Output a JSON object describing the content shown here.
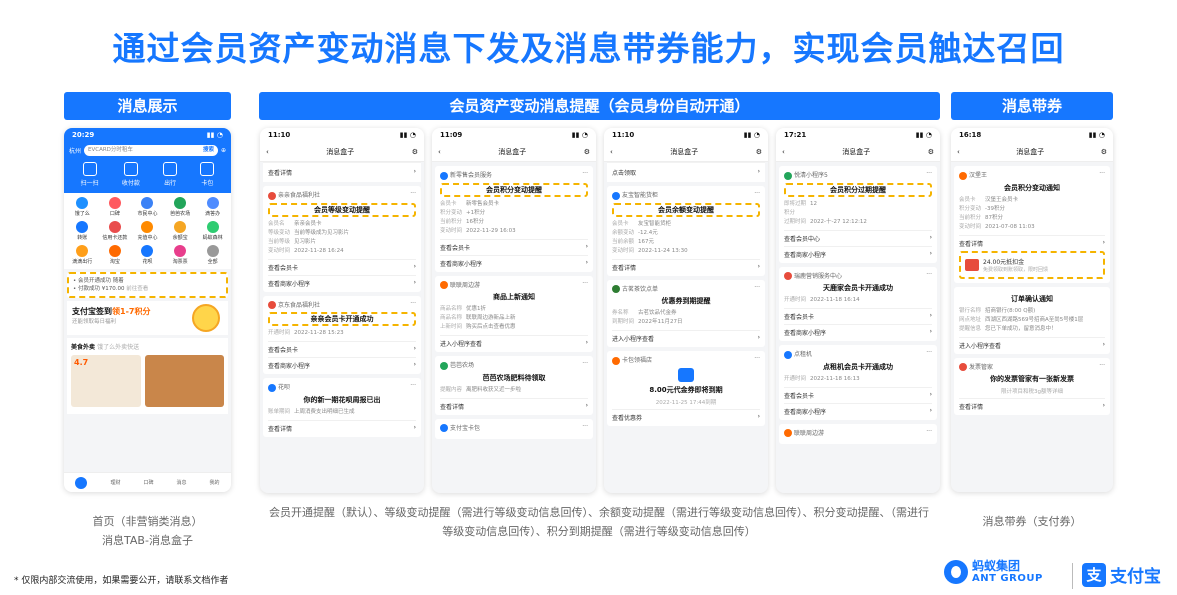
{
  "title": "通过会员资产变动消息下发及消息带券能力，实现会员触达召回",
  "sections": {
    "display": "消息展示",
    "asset": "会员资产变动消息提醒（会员身份自动开通）",
    "coupon": "消息带券"
  },
  "phone1": {
    "time": "20:29",
    "city": "杭州",
    "search_placeholder": "EVCARD分时租车",
    "search_btn": "搜索",
    "top_icons": [
      "扫一扫",
      "收付款",
      "出行",
      "卡包"
    ],
    "grid": [
      "饿了么",
      "口碑",
      "市民中心",
      "芭芭农场",
      "滴答办",
      "转账",
      "信用卡还款",
      "充值中心",
      "余额宝",
      "蚂蚁森林",
      "滴滴出行",
      "淘宝",
      "花呗",
      "淘票票",
      "全部"
    ],
    "msg1": "• 会员开通成功 随着",
    "msg2": "• 付款成功 ¥170.00",
    "msg_suffix": "前往查看",
    "banner_title": "支付宝签到",
    "banner_highlight": "领1-7积分",
    "banner_sub": "还能领取每日福利",
    "food_title": "美食外卖",
    "food_sub": "饿了么外卖快送",
    "food_price": "4.7",
    "tabs": [
      "首页",
      "理财",
      "口碑",
      "消息",
      "我的"
    ]
  },
  "phone2": {
    "time": "11:10",
    "nav_title": "消息盒子",
    "top_link": "查看详情",
    "card1_src": "亲亲食品福利社",
    "card1_title": "会员等级变动提醒",
    "card1_kv": [
      [
        "会员名",
        "亲亲会员卡"
      ],
      [
        "等级变动",
        "当前等级成为见习影片"
      ],
      [
        "当前等级",
        "见习影片"
      ],
      [
        "变动时间",
        "2022-11-28 16:24"
      ]
    ],
    "card1_links": [
      "查看会员卡",
      "查看商家小程序"
    ],
    "card2_src": "京东食品福利社",
    "card2_title": "亲亲会员卡开通成功",
    "card2_kv": [
      [
        "开通时间",
        "2022-11-28 15:23"
      ]
    ],
    "card2_links": [
      "查看会员卡",
      "查看商家小程序"
    ],
    "card3_src": "花呗",
    "card3_title": "你的新一期花呗周报已出",
    "card3_kv": [
      [
        "账单期间",
        "上周消费支出明细已生成"
      ]
    ],
    "card3_links": [
      "查看详情"
    ]
  },
  "phone3": {
    "time": "11:09",
    "nav_title": "消息盒子",
    "card1_src": "新零售会员服务",
    "card1_title": "会员积分变动提醒",
    "card1_kv": [
      [
        "会员卡",
        "新零售会员卡"
      ],
      [
        "积分变动",
        "+1积分"
      ],
      [
        "当前积分",
        "16积分"
      ],
      [
        "变动时间",
        "2022-11-29 16:03"
      ]
    ],
    "card1_links": [
      "查看会员卡",
      "查看商家小程序"
    ],
    "card2_src": "联联周边游",
    "card2_title": "商品上新通知",
    "card2_kv": [
      [
        "商品名称",
        "优惠1折"
      ],
      [
        "商品名称",
        "联联周边游新品上新"
      ],
      [
        "上新时间",
        "购买后点击查看优惠"
      ]
    ],
    "card2_links": [
      "进入小程序查看"
    ],
    "card3_src": "芭芭农场",
    "card3_title": "芭芭农场肥料待领取",
    "card3_kv": [
      [
        "提醒内容",
        "离肥料收获又近一步啦"
      ]
    ],
    "card3_links": [
      "查看详情"
    ],
    "card4_src": "支付宝卡包"
  },
  "phone4": {
    "time": "11:10",
    "nav_title": "消息盒子",
    "top_link": "点击领取",
    "card1_src": "友宝智能货柜",
    "card1_title": "会员余额变动提醒",
    "card1_kv": [
      [
        "会员卡",
        "友宝智能货柜"
      ],
      [
        "余额变动",
        "-12.4元"
      ],
      [
        "当前余额",
        "167元"
      ],
      [
        "变动时间",
        "2022-11-24 13:30"
      ]
    ],
    "card1_links": [
      "查看详情"
    ],
    "card2_src": "古茗茶饮点单",
    "card2_title": "优惠券到期提醒",
    "card2_kv": [
      [
        "券名称",
        "古茗饮品代金券"
      ],
      [
        "到期时间",
        "2022年11月27日"
      ]
    ],
    "card2_links": [
      "进入小程序查看"
    ],
    "card3_src": "卡包领福店",
    "card3_title": "8.00元代金券即将到期",
    "card3_date": "2022-11-25 17:44到期",
    "card3_links": [
      "查看优惠券"
    ]
  },
  "phone5": {
    "time": "17:21",
    "nav_title": "消息盒子",
    "card1_src": "悦清小程序5",
    "card1_title": "会员积分过期提醒",
    "card1_kv": [
      [
        "即将过期积分",
        "12"
      ],
      [
        "过期时间",
        "2022-十-27 12:12:12"
      ]
    ],
    "card1_links": [
      "查看会员中心",
      "查看商家小程序"
    ],
    "card2_src": "瑞鹿营销服务中心",
    "card2_title": "天鹿家会员卡开通成功",
    "card2_kv": [
      [
        "开通时间",
        "2022-11-18 16:14"
      ]
    ],
    "card2_links": [
      "查看会员卡",
      "查看商家小程序"
    ],
    "card3_src": "点租机",
    "card3_title": "点租机会员卡开通成功",
    "card3_kv": [
      [
        "开通时间",
        "2022-11-18 16:13"
      ]
    ],
    "card3_links": [
      "查看会员卡",
      "查看商家小程序"
    ],
    "card4_src": "联联周边游"
  },
  "phone6": {
    "time": "16:18",
    "nav_title": "消息盒子",
    "card1_src": "汉堡王",
    "card1_title": "会员积分变动通知",
    "card1_kv": [
      [
        "会员卡",
        "汉堡王会员卡"
      ],
      [
        "积分变动",
        "-39积分"
      ],
      [
        "当前积分",
        "87积分"
      ],
      [
        "变动时间",
        "2021-07-08 11:03"
      ]
    ],
    "card1_links": [
      "查看详情"
    ],
    "coupon_amount": "24.00元抵扣金",
    "coupon_desc": "免费领取到账领取，限时回馈",
    "card2_title": "订单确认通知",
    "card2_kv": [
      [
        "银行名称",
        "招商银行(8:00 Q额)"
      ],
      [
        "网点地址",
        "西湖区西湖路569号招商A至尚5号楼1层"
      ],
      [
        "提醒信息",
        "您已下单成功，留意消息中！"
      ]
    ],
    "card2_links": [
      "进入小程序查看"
    ],
    "card3_src": "发票管家",
    "card3_title": "你的发票管家有一张新发票",
    "card3_desc": "限计项目和税3g额等详细",
    "card3_links": [
      "查看详情"
    ]
  },
  "captions": {
    "display": "首页（非营销类消息）\n消息TAB-消息盒子",
    "asset": "会员开通提醒（默认）、等级变动提醒（需进行等级变动信息回传）、余额变动提醒（需进行等级变动信息回传）、积分变动提醒、（需进行等级变动信息回传）、积分到期提醒（需进行等级变动信息回传）",
    "coupon": "消息带券（支付券）"
  },
  "footnote": "* 仅限内部交流使用，如果需要公开，请联系文档作者",
  "logos": {
    "ant_cn": "蚂蚁集团",
    "ant_en": "ANT GROUP",
    "alipay": "支付宝"
  },
  "colors": {
    "brand": "#1677ff",
    "highlight": "#f5b400"
  }
}
